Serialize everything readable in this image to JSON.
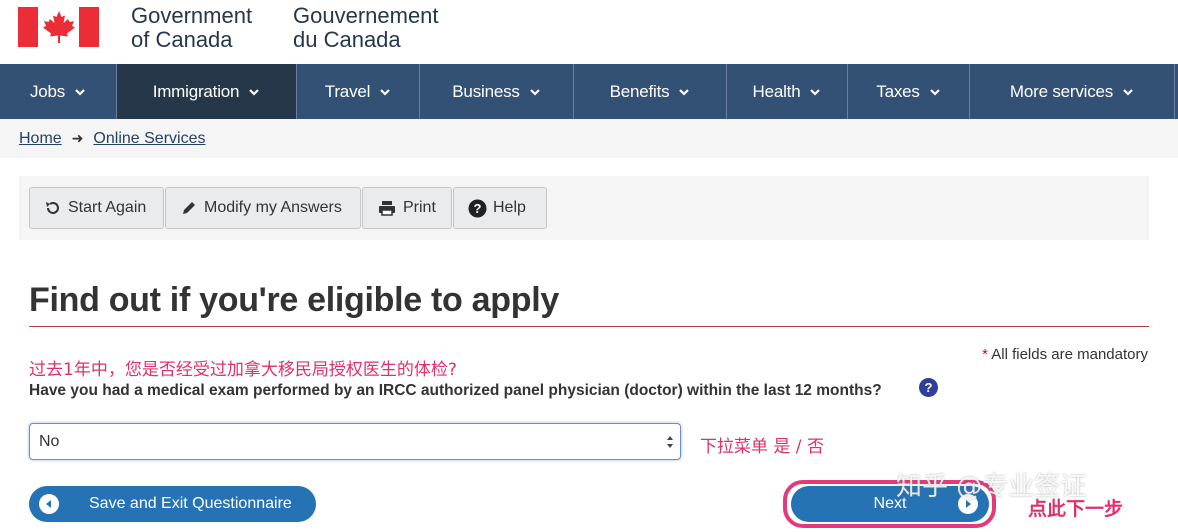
{
  "header": {
    "signature_en_line1": "Government",
    "signature_en_line2": "of Canada",
    "signature_fr_line1": "Gouvernement",
    "signature_fr_line2": "du Canada"
  },
  "nav": {
    "items": [
      {
        "label": "Jobs"
      },
      {
        "label": "Immigration"
      },
      {
        "label": "Travel"
      },
      {
        "label": "Business"
      },
      {
        "label": "Benefits"
      },
      {
        "label": "Health"
      },
      {
        "label": "Taxes"
      },
      {
        "label": "More services"
      }
    ]
  },
  "breadcrumb": {
    "home": "Home",
    "current": "Online Services"
  },
  "toolbar": {
    "start_again": "Start Again",
    "modify": "Modify my Answers",
    "print": "Print",
    "help": "Help"
  },
  "page": {
    "title": "Find out if you're eligible to apply",
    "mandatory_note": "All fields are mandatory",
    "question": "Have you had a medical exam performed by an IRCC authorized panel physician (doctor) within the last 12 months?",
    "help_glyph": "?",
    "select_value": "No"
  },
  "annotations": {
    "question_cn": "过去1年中，您是否经受过加拿大移民局授权医生的体检?",
    "select_cn": "下拉菜单 是 / 否",
    "next_cn": "点此下一步",
    "watermark": "知乎 @专业签证"
  },
  "buttons": {
    "save_exit": "Save and Exit Questionnaire",
    "next": "Next"
  },
  "colors": {
    "nav_bg": "#335075",
    "nav_active": "#26374a",
    "flag_red": "#eb2d37",
    "button_blue": "#2572b4",
    "annotation_pink": "#e0306a",
    "title_rule": "#af3c43"
  }
}
